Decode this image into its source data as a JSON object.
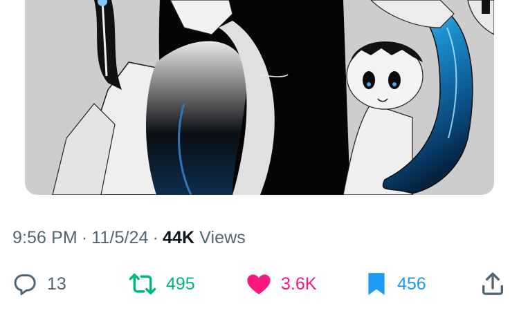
{
  "tweet": {
    "time": "9:56 PM",
    "date": "11/5/24",
    "views_count": "44K",
    "views_label": "Views",
    "separator": "·"
  },
  "actions": {
    "replies": "13",
    "reposts": "495",
    "likes": "3.6K",
    "bookmarks": "456"
  },
  "icons": {
    "reply": "speech-bubble-icon",
    "repost": "repost-arrows-icon",
    "like": "heart-filled-icon",
    "bookmark": "bookmark-filled-icon",
    "share": "share-upload-icon"
  },
  "colors": {
    "repost": "#00ba7c",
    "like": "#f91880",
    "bookmark": "#1d9bf0",
    "secondary_text": "#536471",
    "primary_text": "#0f1419"
  }
}
